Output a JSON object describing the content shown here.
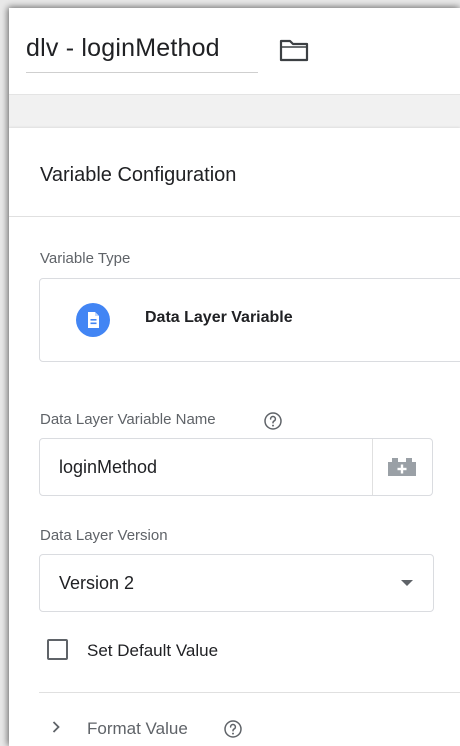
{
  "header": {
    "title": "dlv - loginMethod",
    "folder_icon": "folder-icon"
  },
  "config": {
    "card_title": "Variable Configuration",
    "variable_type": {
      "label": "Variable Type",
      "value": "Data Layer Variable",
      "icon": "document-icon",
      "icon_color": "#4285f4"
    },
    "name_field": {
      "label": "Data Layer Variable Name",
      "value": "loginMethod",
      "help_icon": "help-icon",
      "variable_picker_icon": "brick-icon"
    },
    "version_field": {
      "label": "Data Layer Version",
      "selected": "Version 2"
    },
    "default_value": {
      "label": "Set Default Value",
      "checked": false
    },
    "format_value": {
      "label": "Format Value",
      "expanded": false
    }
  }
}
